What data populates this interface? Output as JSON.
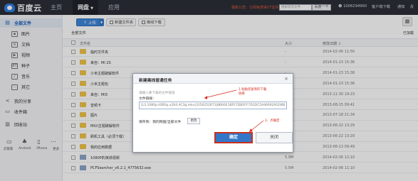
{
  "topbar": {
    "logo_text": "百度云",
    "nav": [
      "主页",
      "网盘",
      "应用"
    ],
    "promo": "最新公告：订阅免费得1T空间",
    "search_placeholder": "搜索您的文件",
    "search_button": "百度一下",
    "user": "1006294960",
    "client_download": "客户端下载",
    "notifications": "通知",
    "more": "反"
  },
  "sidebar": {
    "items": [
      {
        "label": "全部文件",
        "icon": "folder-icon"
      },
      {
        "label": "图片",
        "icon": "image-icon"
      },
      {
        "label": "文档",
        "icon": "document-icon"
      },
      {
        "label": "视频",
        "icon": "video-icon"
      },
      {
        "label": "种子",
        "icon": "torrent-icon"
      },
      {
        "label": "音乐",
        "icon": "music-icon"
      },
      {
        "label": "其它",
        "icon": "other-icon"
      },
      {
        "label": "我的分享",
        "icon": "share-icon"
      },
      {
        "label": "收件箱",
        "icon": "inbox-icon"
      },
      {
        "label": "回收站",
        "icon": "trash-icon"
      }
    ],
    "devices": [
      "云管家",
      "Android",
      "iPhone",
      "更多"
    ]
  },
  "toolbar": {
    "upload": "上传",
    "new_folder": "新建文件夹",
    "offline_download": "离线下载"
  },
  "breadcrumb": "全部文件",
  "loaded_text": "已加载",
  "table": {
    "headers": {
      "name": "文件名",
      "size": "大小",
      "date": "修改日期"
    },
    "rows": [
      {
        "name": "临时文件夹",
        "size": "-",
        "date": "2014-02-06 11:50",
        "type": "folder"
      },
      {
        "name": "来自：MI 2S",
        "size": "-",
        "date": "2014-01-23 15:36",
        "type": "folder"
      },
      {
        "name": "小米主题破解软件",
        "size": "-",
        "date": "2014-01-23 15:38",
        "type": "folder"
      },
      {
        "name": "小米主题包",
        "size": "-",
        "date": "2014-01-23 15:36",
        "type": "folder"
      },
      {
        "name": "来自：MI3",
        "size": "-",
        "date": "2013-11-30 19:23",
        "type": "folder"
      },
      {
        "name": "音频卡",
        "size": "-",
        "date": "2013-08-15 09:41",
        "type": "folder"
      },
      {
        "name": "图片",
        "size": "-",
        "date": "2013-07-18 21:34",
        "type": "folder"
      },
      {
        "name": "MIUI主题破解软件",
        "size": "-",
        "date": "2013-06-22 13:29",
        "type": "folder"
      },
      {
        "name": "刷机工具（必须下载）",
        "size": "-",
        "date": "2013-06-22 13:29",
        "type": "folder"
      },
      {
        "name": "我的应用数据",
        "size": "-",
        "date": "2013-06-13 09:49",
        "type": "folder"
      },
      {
        "name": "1080P的演讲视频",
        "size": "5.9M",
        "date": "2014-02-06 12:10",
        "type": "file"
      },
      {
        "name": "PCFSearcher_v6.2.1_4775632.exe",
        "size": "5.5M",
        "date": "2014-02-06 11:10",
        "type": "file"
      }
    ]
  },
  "dialog": {
    "title": "新建离线普通任务",
    "hint": "请输入要下载的文件链接",
    "link_label": "文件链接：",
    "link_value": "[L3.1080p.HDRip.x264.AC3g.mkv|3156252671|8B00E1BFE7DB5FF7D1DC5A4669291E8B|",
    "save_to": "保存到：我的网盘/全部文件",
    "change": "更改",
    "confirm": "确定",
    "close": "关闭"
  },
  "annotations": {
    "first_line1": "1.粘贴您复制的下载",
    "first_line2": "链接",
    "second": "2、点确定"
  }
}
